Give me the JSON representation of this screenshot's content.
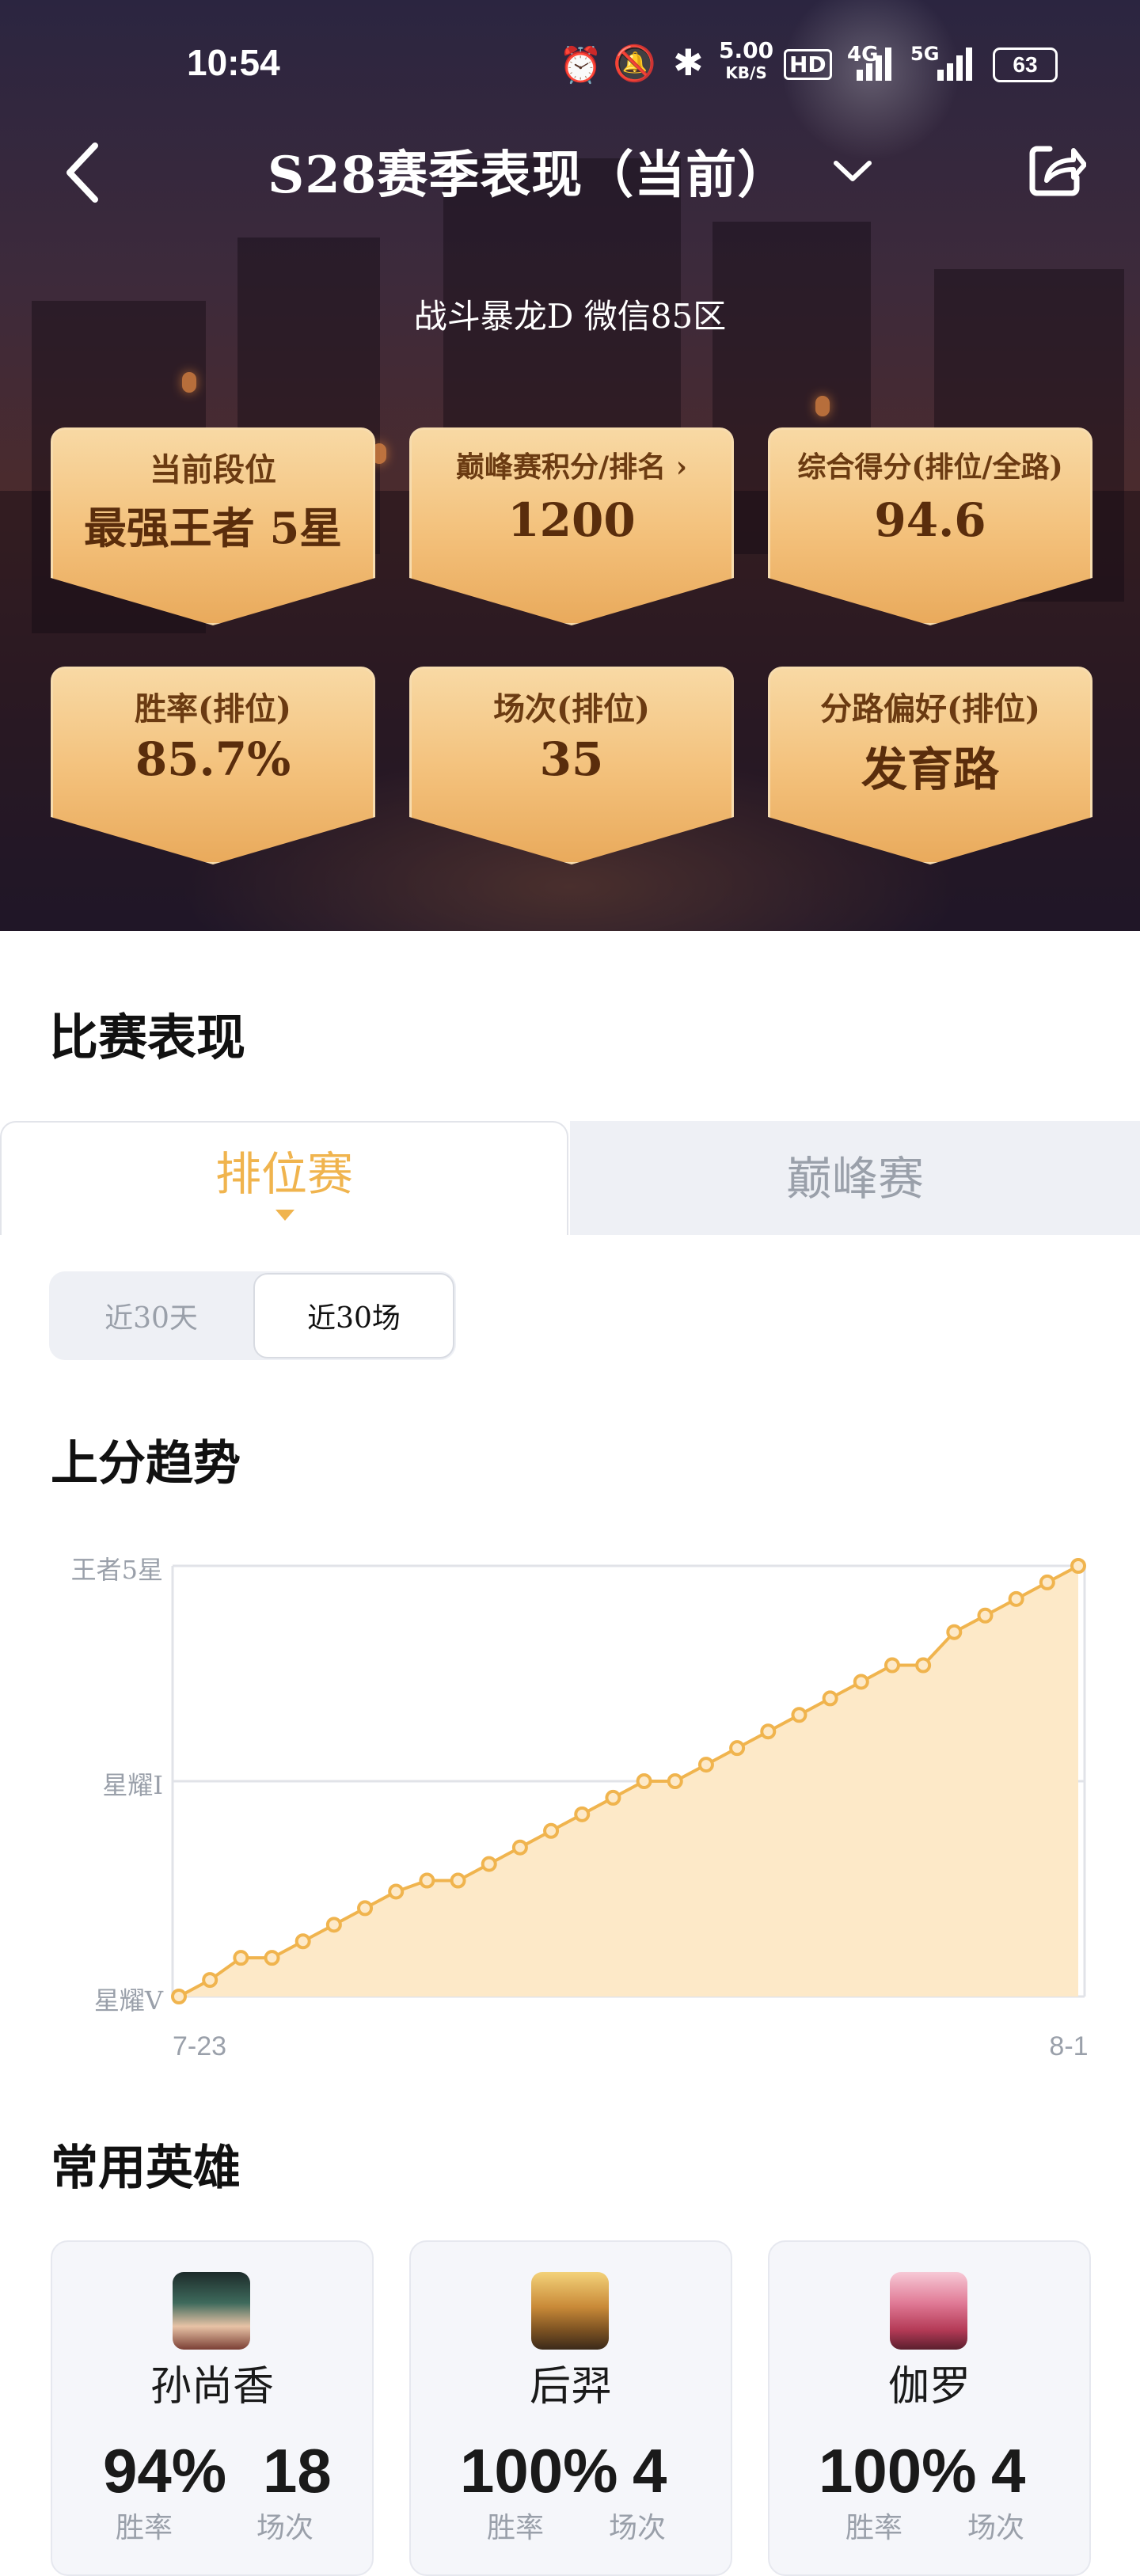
{
  "status_bar": {
    "time": "10:54",
    "net_speed": "5.00",
    "net_unit": "KB/S",
    "hd": "HD",
    "net_4g": "4G",
    "net_5g": "5G",
    "battery": "63"
  },
  "header": {
    "title": "S28赛季表现（当前）",
    "player": "战斗暴龙D  微信85区"
  },
  "stat_cards": [
    {
      "label": "当前段位",
      "value": "最强王者 5星"
    },
    {
      "label": "巅峰赛积分/排名",
      "value": "1200"
    },
    {
      "label": "综合得分(排位/全路)",
      "value": "94.6"
    },
    {
      "label": "胜率(排位)",
      "value": "85.7%"
    },
    {
      "label": "场次(排位)",
      "value": "35"
    },
    {
      "label": "分路偏好(排位)",
      "value": "发育路"
    }
  ],
  "section_match": "比赛表现",
  "tabs": {
    "ranked": "排位赛",
    "peak": "巅峰赛",
    "active": "ranked"
  },
  "filters": {
    "days30": "近30天",
    "games30": "近30场",
    "active": "games30"
  },
  "section_trend": "上分趋势",
  "chart_data": {
    "type": "area",
    "title": "上分趋势",
    "y_tick_labels": [
      "王者5星",
      "星耀I",
      "星耀V"
    ],
    "x_tick_labels": [
      "7-23",
      "8-1"
    ],
    "x_count": 30,
    "values": [
      0,
      3,
      7,
      7,
      10,
      13,
      16,
      19,
      21,
      21,
      24,
      27,
      30,
      33,
      36,
      39,
      39,
      42,
      45,
      48,
      51,
      54,
      57,
      60,
      60,
      66,
      69,
      72,
      75,
      78
    ],
    "y_range": [
      0,
      78
    ],
    "color": "#f0b44e",
    "fill": "#fde9c8"
  },
  "section_heroes": "常用英雄",
  "heroes": [
    {
      "name": "孙尚香",
      "winrate": "94%",
      "games": "18",
      "winrate_label": "胜率",
      "games_label": "场次",
      "avatar": "sunshangxiang-avatar"
    },
    {
      "name": "后羿",
      "winrate": "100%",
      "games": "4",
      "winrate_label": "胜率",
      "games_label": "场次",
      "avatar": "houyi-avatar"
    },
    {
      "name": "伽罗",
      "winrate": "100%",
      "games": "4",
      "winrate_label": "胜率",
      "games_label": "场次",
      "avatar": "jialuo-avatar"
    }
  ]
}
